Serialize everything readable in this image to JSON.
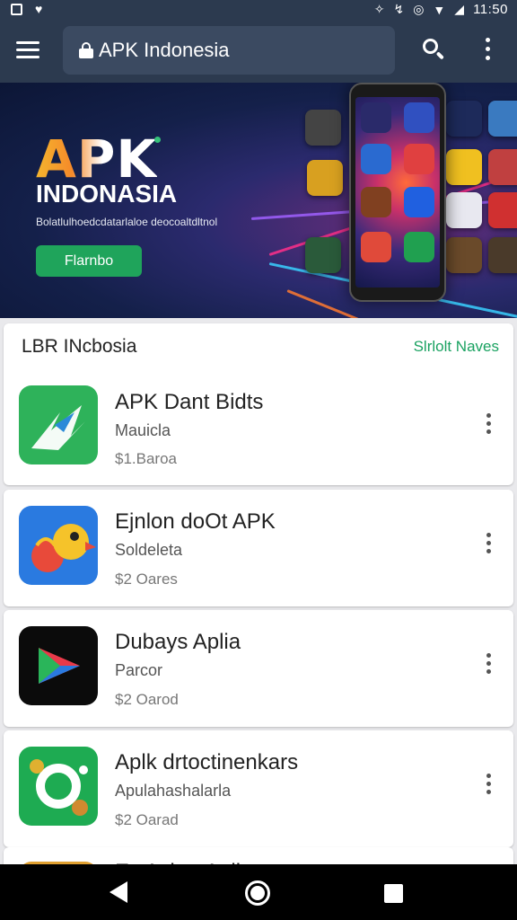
{
  "status_bar": {
    "time": "11:50"
  },
  "toolbar": {
    "url": "APK Indonesia"
  },
  "banner": {
    "brand_title": "APK",
    "brand_subtitle": "INDONASIA",
    "tagline": "Bolatlulhoedcdatarlaloe deocoaltdltnol",
    "button_label": "Flarnbo"
  },
  "list": {
    "header": "LBR INcbosia",
    "link": "Slrlolt Naves",
    "items": [
      {
        "title": "APK Dant Bidts",
        "subtitle": "Mauicla",
        "meta": "$1.Baroa",
        "icon": "apk-arrow-icon"
      },
      {
        "title": "Ejnlon doOt APK",
        "subtitle": "Soldeleta",
        "meta": "$2 Oares",
        "icon": "parrot-icon"
      },
      {
        "title": "Dubays Aplia",
        "subtitle": "Parcor",
        "meta": "$2 Oarod",
        "icon": "play-triangle-icon"
      },
      {
        "title": "Aplk drtoctinenkars",
        "subtitle": "Apulahashalarla",
        "meta": "$2 Oarad",
        "icon": "gear-pins-icon"
      },
      {
        "title": "Ex Ashpt Aplia",
        "subtitle": "",
        "meta": "",
        "icon": "partial-app-icon"
      }
    ]
  },
  "colors": {
    "toolbar": "#2c3a4f",
    "accent": "#1aa261",
    "banner_button": "#1fa45b"
  }
}
